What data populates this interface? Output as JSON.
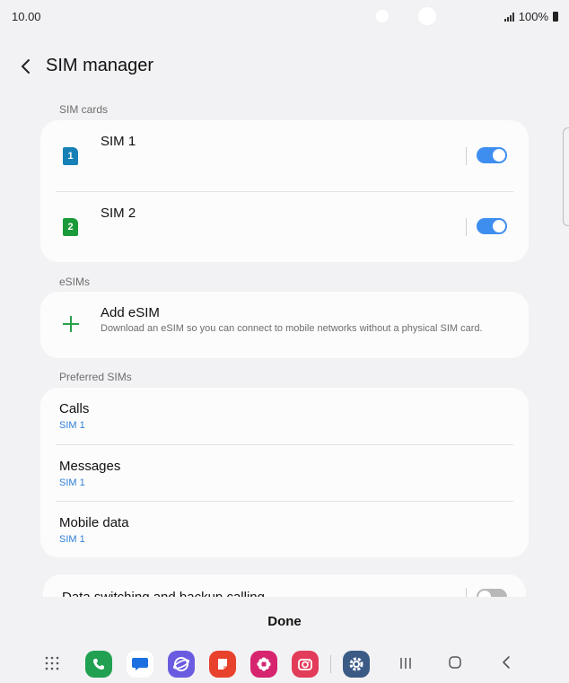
{
  "status": {
    "time": "10.00",
    "battery": "100%"
  },
  "header": {
    "title": "SIM manager"
  },
  "sections": {
    "sim_cards": "SIM cards",
    "esims": "eSIMs",
    "preferred": "Preferred SIMs"
  },
  "sims": [
    {
      "number": "1",
      "label": "SIM 1",
      "enabled": true,
      "color": "#1780b6"
    },
    {
      "number": "2",
      "label": "SIM 2",
      "enabled": true,
      "color": "#1a9a39"
    }
  ],
  "esim": {
    "title": "Add eSIM",
    "description": "Download an eSIM so you can connect to mobile networks without a physical SIM card."
  },
  "preferred": [
    {
      "label": "Calls",
      "value": "SIM 1"
    },
    {
      "label": "Messages",
      "value": "SIM 1"
    },
    {
      "label": "Mobile data",
      "value": "SIM 1"
    }
  ],
  "data_switching": {
    "label": "Data switching and backup calling",
    "enabled": false
  },
  "footer": {
    "done": "Done"
  },
  "nav": {
    "apps": [
      "apps-grid-icon",
      "phone-icon",
      "messages-icon",
      "internet-icon",
      "notes-icon",
      "gallery-icon",
      "camera-icon",
      "settings-icon"
    ],
    "buttons": [
      "recents-icon",
      "home-icon",
      "back-icon"
    ]
  },
  "colors": {
    "accent": "#3e8ef0",
    "link": "#2f7fd8",
    "add": "#2aa14a"
  }
}
